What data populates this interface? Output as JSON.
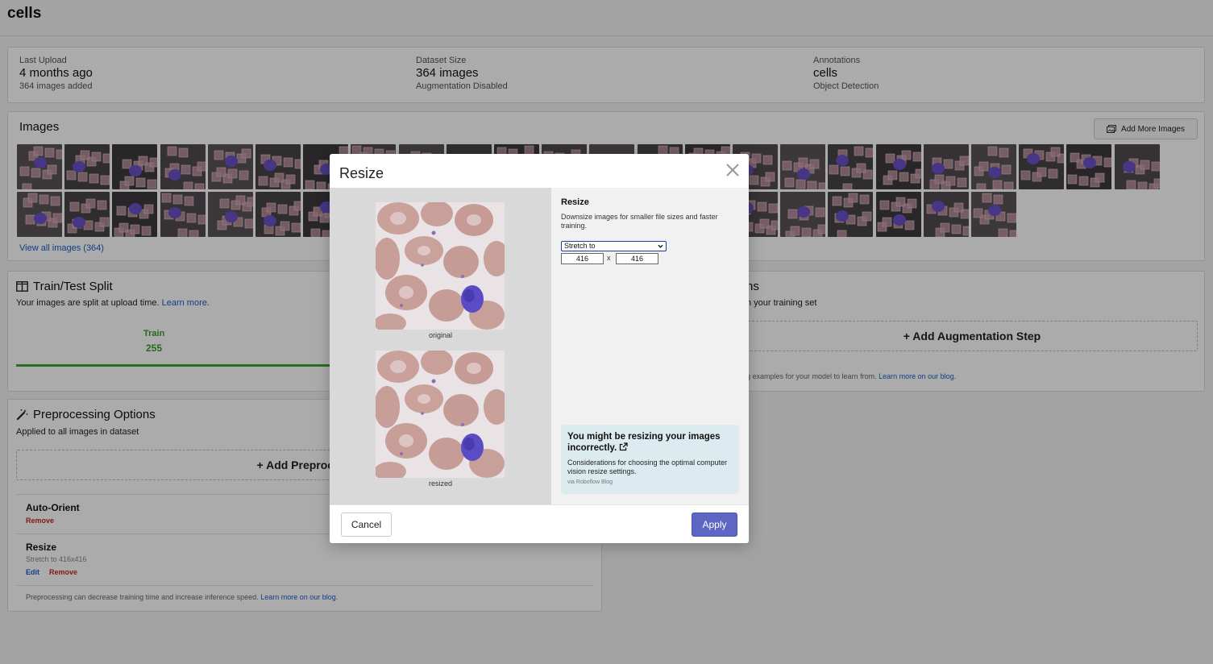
{
  "project": {
    "title": "cells"
  },
  "stats": [
    {
      "label": "Last Upload",
      "value": "4 months ago",
      "sub": "364 images added"
    },
    {
      "label": "Dataset Size",
      "value": "364 images",
      "sub": "Augmentation Disabled"
    },
    {
      "label": "Annotations",
      "value": "cells",
      "sub": "Object Detection"
    }
  ],
  "images": {
    "title": "Images",
    "add_more_label": "Add More Images",
    "view_all": "View all images (364)"
  },
  "split": {
    "title": "Train/Test Split",
    "desc": "Your images are split at upload time.",
    "learn_more": "Learn more.",
    "train_label": "Train",
    "train_count": "255",
    "train_color": "#3a9b32"
  },
  "augmentation": {
    "title_fragment": "ns",
    "desc_fragment": "n your training set",
    "add_step": "+ Add Augmentation Step",
    "foot_fragment": "g examples for your model to learn from.",
    "foot_link": "Learn more on our blog."
  },
  "preprocessing": {
    "title": "Preprocessing Options",
    "desc": "Applied to all images in dataset",
    "add_step": "+ Add Preprocess",
    "steps": [
      {
        "name": "Auto-Orient",
        "remove": "Remove"
      },
      {
        "name": "Resize",
        "detail": "Stretch to 416x416",
        "edit": "Edit",
        "remove": "Remove"
      }
    ],
    "foot": "Preprocessing can decrease training time and increase inference speed.",
    "foot_link": "Learn more on our blog."
  },
  "modal": {
    "title": "Resize",
    "original_caption": "original",
    "resized_caption": "resized",
    "heading": "Resize",
    "desc": "Downsize images for smaller file sizes and faster training.",
    "mode": "Stretch to",
    "width": "416",
    "x": "x",
    "height": "416",
    "tip_title": "You might be resizing your images incorrectly.",
    "tip_body": "Considerations for choosing the optimal computer vision resize settings.",
    "tip_source": "via Roboflow Blog",
    "cancel": "Cancel",
    "apply": "Apply",
    "apply_color": "#5e66c4"
  },
  "icons": [
    "split-icon",
    "magic-wand-icon",
    "images-icon",
    "close-icon",
    "external-link-icon",
    "chevron-down-icon"
  ]
}
